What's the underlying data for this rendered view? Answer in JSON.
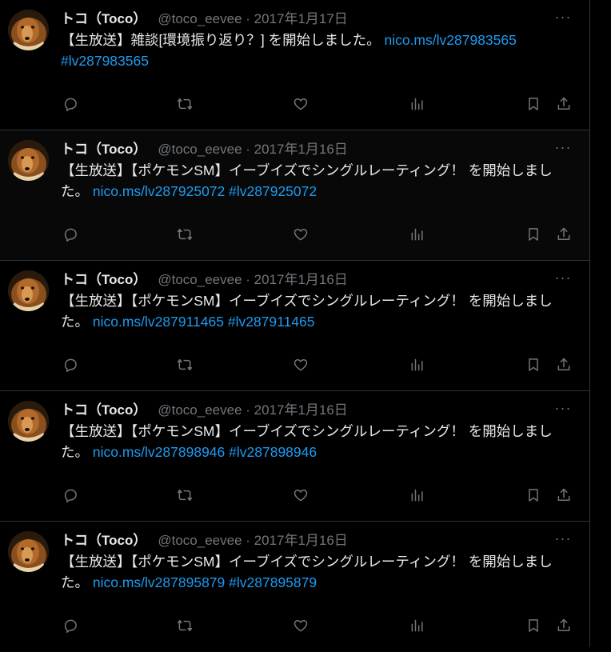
{
  "tweets": [
    {
      "name": "トコ（Toco）",
      "meta": "@toco_eevee · 2017年1月17日",
      "more": "···",
      "text": "【生放送】雑談[環境振り返り？] を開始しました。",
      "link": "nico.ms/lv287983565",
      "hashtag": "#lv287983565"
    },
    {
      "name": "トコ（Toco）",
      "meta": "@toco_eevee · 2017年1月16日",
      "more": "···",
      "text": "【生放送】【ポケモンSM】イーブイズでシングルレーティング！ を開始しました。",
      "link": "nico.ms/lv287925072",
      "hashtag": "#lv287925072"
    },
    {
      "name": "トコ（Toco）",
      "meta": "@toco_eevee · 2017年1月16日",
      "more": "···",
      "text": "【生放送】【ポケモンSM】イーブイズでシングルレーティング！ を開始しました。",
      "link": "nico.ms/lv287911465",
      "hashtag": "#lv287911465"
    },
    {
      "name": "トコ（Toco）",
      "meta": "@toco_eevee · 2017年1月16日",
      "more": "···",
      "text": "【生放送】【ポケモンSM】イーブイズでシングルレーティング！ を開始しました。",
      "link": "nico.ms/lv287898946",
      "hashtag": "#lv287898946"
    },
    {
      "name": "トコ（Toco）",
      "meta": "@toco_eevee · 2017年1月16日",
      "more": "···",
      "text": "【生放送】【ポケモンSM】イーブイズでシングルレーティング！ を開始しました。",
      "link": "nico.ms/lv287895879",
      "hashtag": "#lv287895879"
    }
  ],
  "icons": {
    "reply": "reply-icon",
    "retweet": "retweet-icon",
    "like": "heart-icon",
    "views": "views-icon",
    "bookmark": "bookmark-icon",
    "share": "share-icon",
    "more": "more-icon"
  },
  "colors": {
    "background": "#000000",
    "text": "#e7e9ea",
    "muted": "#71767b",
    "link": "#1d9bf0",
    "divider": "#2f3336"
  }
}
